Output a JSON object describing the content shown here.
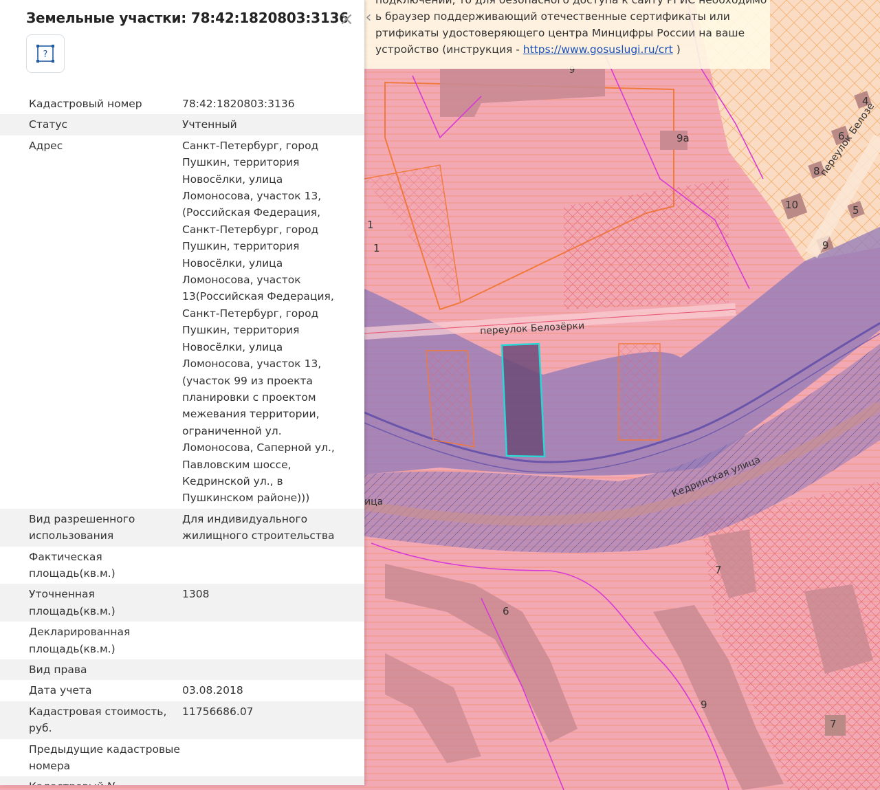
{
  "panel": {
    "title": "Земельные участки: 78:42:1820803:3136",
    "parcel_button_icon": "parcel-question-icon",
    "close_icon": "close-icon",
    "rows": [
      {
        "key": "Кадастровый номер",
        "value": "78:42:1820803:3136"
      },
      {
        "key": "Статус",
        "value": "Учтенный"
      },
      {
        "key": "Адрес",
        "value": "Санкт-Петербург, город Пушкин, территория Новосёлки, улица Ломоносова, участок 13, (Российская Федерация, Санкт-Петербург, город Пушкин, территория Новосёлки, улица Ломоносова, участок 13(Российская Федерация, Санкт-Петербург, город Пушкин, территория Новосёлки, улица Ломоносова, участок 13, (участок 99 из проекта планировки с проектом межевания территории, ограниченной ул. Ломоносова, Саперной ул., Павловским шоссе, Кедринской ул., в Пушкинском районе)))"
      },
      {
        "key": "Вид разрешенного использования",
        "value": "Для индивидуального жилищного строительства"
      },
      {
        "key": "Фактическая площадь(кв.м.)",
        "value": ""
      },
      {
        "key": "Уточненная площадь(кв.м.)",
        "value": "1308"
      },
      {
        "key": "Декларированная площадь(кв.м.)",
        "value": ""
      },
      {
        "key": "Вид права",
        "value": ""
      },
      {
        "key": "Дата учета",
        "value": "03.08.2018"
      },
      {
        "key": "Кадастровая стоимость, руб.",
        "value": "11756686.07"
      },
      {
        "key": "Предыдущие кадастровые номера",
        "value": ""
      },
      {
        "key": "Кадастровый №",
        "value": ""
      }
    ]
  },
  "notice": {
    "line1": "подключении, то для безопасного доступа к сайту РГИС необходимо",
    "line2": "ь браузер поддерживающий отечественные сертификаты или",
    "line3": "ртификаты удостоверяющего центра Минцифры России на ваше",
    "line4_prefix": "устройство (инструкция - ",
    "link": "https://www.gosuslugi.ru/crt",
    "line4_suffix": " )",
    "collapse_icon": "chevron-left-icon"
  },
  "map": {
    "street_labels": {
      "belozerki_lane": "переулок Белозёрки",
      "belozerki_lane_ne": "переулок Белозе",
      "kedrinskaya": "Кедринская улица",
      "street_fragment": "ица"
    },
    "house_numbers": {
      "n9_top": "9",
      "n9a": "9а",
      "n4": "4",
      "n6_ne": "6",
      "n8": "8",
      "n10": "10",
      "n5": "5",
      "n9_ne": "9",
      "n1_a": "1",
      "n1_b": "1",
      "n7_right": "7",
      "n6_lower": "6",
      "n9_lower": "9",
      "n7_lower": "7"
    },
    "colors": {
      "zone_pink": "#f3a9b4",
      "water_zone": "#9b86c0",
      "selected_parcel_outline": "#2bd6d6",
      "boundary_orange": "#f07a3c",
      "boundary_magenta": "#d63ad6"
    }
  }
}
